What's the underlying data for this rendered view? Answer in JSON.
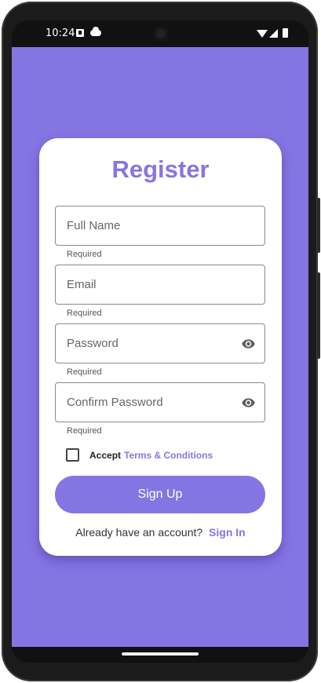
{
  "status_bar": {
    "time": "10:24",
    "icons": [
      "a-notification-icon",
      "cloud-icon",
      "wifi-icon",
      "signal-icon",
      "battery-icon"
    ]
  },
  "register": {
    "title": "Register",
    "fields": [
      {
        "label": "Full Name",
        "helper": "Required",
        "value": ""
      },
      {
        "label": "Email",
        "helper": "Required",
        "value": ""
      },
      {
        "label": "Password",
        "helper": "Required",
        "value": "",
        "trailing_icon": "eye-icon"
      },
      {
        "label": "Confirm Password",
        "helper": "Required",
        "value": "",
        "trailing_icon": "eye-icon"
      }
    ],
    "terms": {
      "accept_label": "Accept",
      "link_label": "Terms & Conditions",
      "checked": false
    },
    "signup_label": "Sign Up",
    "already_text": "Already have an account?",
    "signin_label": "Sign In"
  },
  "colors": {
    "accent": "#8575e3",
    "card": "#ffffff",
    "system_bar": "#111111"
  }
}
